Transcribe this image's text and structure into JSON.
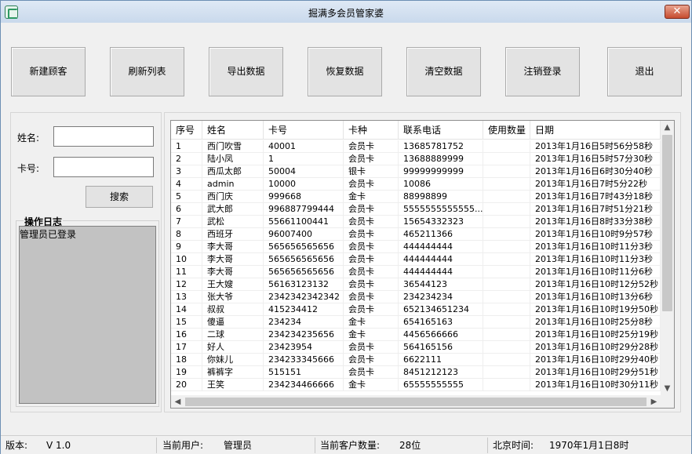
{
  "window": {
    "title": "掘满多会员管家婆",
    "close_glyph": "✕"
  },
  "toolbar": [
    {
      "label": "新建顾客"
    },
    {
      "label": "刷新列表"
    },
    {
      "label": "导出数据"
    },
    {
      "label": "恢复数据"
    },
    {
      "label": "清空数据"
    },
    {
      "label": "注销登录"
    },
    {
      "label": "退出"
    }
  ],
  "search": {
    "name_label": "姓名:",
    "name_value": "",
    "card_label": "卡号:",
    "card_value": "",
    "button_label": "搜索"
  },
  "log": {
    "title": "操作日志",
    "text": "管理员已登录"
  },
  "table": {
    "columns": [
      "序号",
      "姓名",
      "卡号",
      "卡种",
      "联系电话",
      "使用数量",
      "日期"
    ],
    "rows": [
      [
        "1",
        "西门吹雪",
        "40001",
        "会员卡",
        "13685781752",
        "",
        "2013年1月16日5时56分58秒"
      ],
      [
        "2",
        "陆小凤",
        "1",
        "会员卡",
        "13688889999",
        "",
        "2013年1月16日5时57分30秒"
      ],
      [
        "3",
        "西瓜太郎",
        "50004",
        "银卡",
        "99999999999",
        "",
        "2013年1月16日6时30分40秒"
      ],
      [
        "4",
        "admin",
        "10000",
        "会员卡",
        "10086",
        "",
        "2013年1月16日7时5分22秒"
      ],
      [
        "5",
        "西门庆",
        "999668",
        "金卡",
        "88998899",
        "",
        "2013年1月16日7时43分18秒"
      ],
      [
        "6",
        "武大郎",
        "996887799444",
        "会员卡",
        "5555555555555...",
        "",
        "2013年1月16日7时51分21秒"
      ],
      [
        "7",
        "武松",
        "55661100441",
        "会员卡",
        "15654332323",
        "",
        "2013年1月16日8时33分38秒"
      ],
      [
        "8",
        "西班牙",
        "96007400",
        "会员卡",
        "465211366",
        "",
        "2013年1月16日10时9分57秒"
      ],
      [
        "9",
        "李大哥",
        "565656565656",
        "会员卡",
        "444444444",
        "",
        "2013年1月16日10时11分3秒"
      ],
      [
        "10",
        "李大哥",
        "565656565656",
        "会员卡",
        "444444444",
        "",
        "2013年1月16日10时11分3秒"
      ],
      [
        "11",
        "李大哥",
        "565656565656",
        "会员卡",
        "444444444",
        "",
        "2013年1月16日10时11分6秒"
      ],
      [
        "12",
        "王大嫂",
        "56163123132",
        "会员卡",
        "36544123",
        "",
        "2013年1月16日10时12分52秒"
      ],
      [
        "13",
        "张大爷",
        "2342342342342",
        "会员卡",
        "234234234",
        "",
        "2013年1月16日10时13分6秒"
      ],
      [
        "14",
        "叔叔",
        "415234412",
        "会员卡",
        "652134651234",
        "",
        "2013年1月16日10时19分50秒"
      ],
      [
        "15",
        "傻逼",
        "234234",
        "金卡",
        "654165163",
        "",
        "2013年1月16日10时25分8秒"
      ],
      [
        "16",
        "二球",
        "234234235656",
        "金卡",
        "4456566666",
        "",
        "2013年1月16日10时25分19秒"
      ],
      [
        "17",
        "好人",
        "23423954",
        "会员卡",
        "564165156",
        "",
        "2013年1月16日10时29分28秒"
      ],
      [
        "18",
        "你妹儿",
        "234233345666",
        "会员卡",
        "6622111",
        "",
        "2013年1月16日10时29分40秒"
      ],
      [
        "19",
        "裤裤字",
        "515151",
        "会员卡",
        "8451212123",
        "",
        "2013年1月16日10时29分51秒"
      ],
      [
        "20",
        "王笑",
        "234234466666",
        "金卡",
        "65555555555",
        "",
        "2013年1月16日10时30分11秒"
      ]
    ]
  },
  "status": {
    "version_label": "版本:",
    "version_value": "V 1.0",
    "user_label": "当前用户:",
    "user_value": "管理员",
    "count_label": "当前客户数量:",
    "count_value": "28位",
    "time_label": "北京时间:",
    "time_value": "1970年1月1日8时"
  }
}
